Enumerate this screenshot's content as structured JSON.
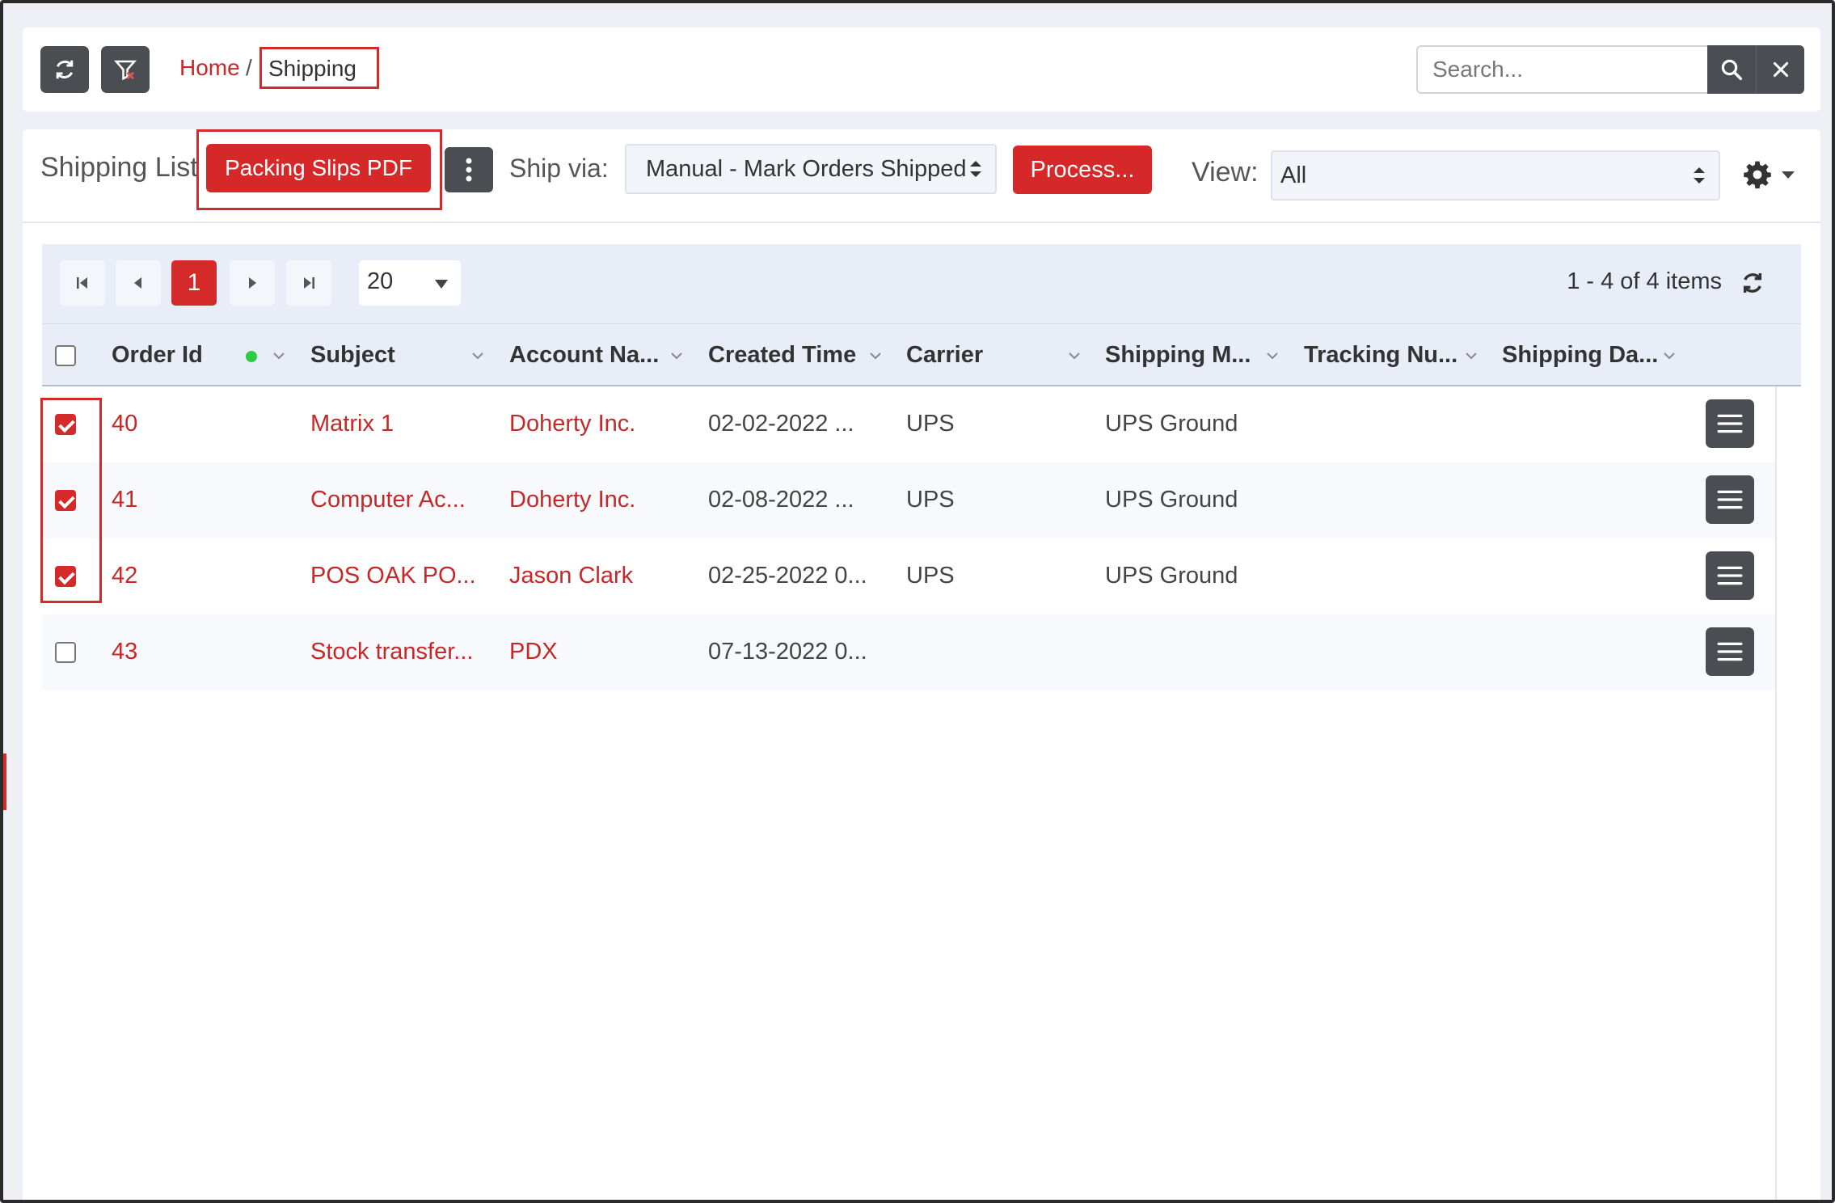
{
  "breadcrumb": {
    "home": "Home",
    "separator": "/",
    "current": "Shipping"
  },
  "search": {
    "placeholder": "Search..."
  },
  "toolbar": {
    "title": "Shipping List",
    "packing_slips_label": "Packing Slips PDF",
    "ship_via_label": "Ship via:",
    "ship_via_value": "Manual - Mark Orders Shipped",
    "process_label": "Process...",
    "view_label": "View:",
    "view_value": "All"
  },
  "pager": {
    "current_page": "1",
    "page_size": "20",
    "items_info": "1 - 4 of 4 items"
  },
  "columns": [
    "Order Id",
    "Subject",
    "Account Na...",
    "Created Time",
    "Carrier",
    "Shipping M...",
    "Tracking Nu...",
    "Shipping Da..."
  ],
  "rows": [
    {
      "checked": true,
      "order_id": "40",
      "subject": "Matrix 1",
      "account": "Doherty Inc.",
      "created": "02-02-2022 ...",
      "carrier": "UPS",
      "shipping_method": "UPS Ground",
      "tracking": "",
      "shipping_date": ""
    },
    {
      "checked": true,
      "order_id": "41",
      "subject": "Computer Ac...",
      "account": "Doherty Inc.",
      "created": "02-08-2022 ...",
      "carrier": "UPS",
      "shipping_method": "UPS Ground",
      "tracking": "",
      "shipping_date": ""
    },
    {
      "checked": true,
      "order_id": "42",
      "subject": "POS OAK PO...",
      "account": "Jason Clark",
      "created": "02-25-2022 0...",
      "carrier": "UPS",
      "shipping_method": "UPS Ground",
      "tracking": "",
      "shipping_date": ""
    },
    {
      "checked": false,
      "order_id": "43",
      "subject": "Stock transfer...",
      "account": "PDX",
      "created": "07-13-2022 0...",
      "carrier": "",
      "shipping_method": "",
      "tracking": "",
      "shipping_date": ""
    }
  ],
  "colors": {
    "accent": "#d42a2a",
    "dark_button": "#4a4d52",
    "header_bg": "#e9edf8",
    "status_dot": "#2ecc40"
  },
  "icons": [
    "refresh-icon",
    "filter-clear-icon",
    "search-icon",
    "close-icon",
    "kebab-icon",
    "sort-updown-icon",
    "gear-icon",
    "first-page-icon",
    "prev-page-icon",
    "next-page-icon",
    "last-page-icon",
    "hamburger-icon"
  ]
}
